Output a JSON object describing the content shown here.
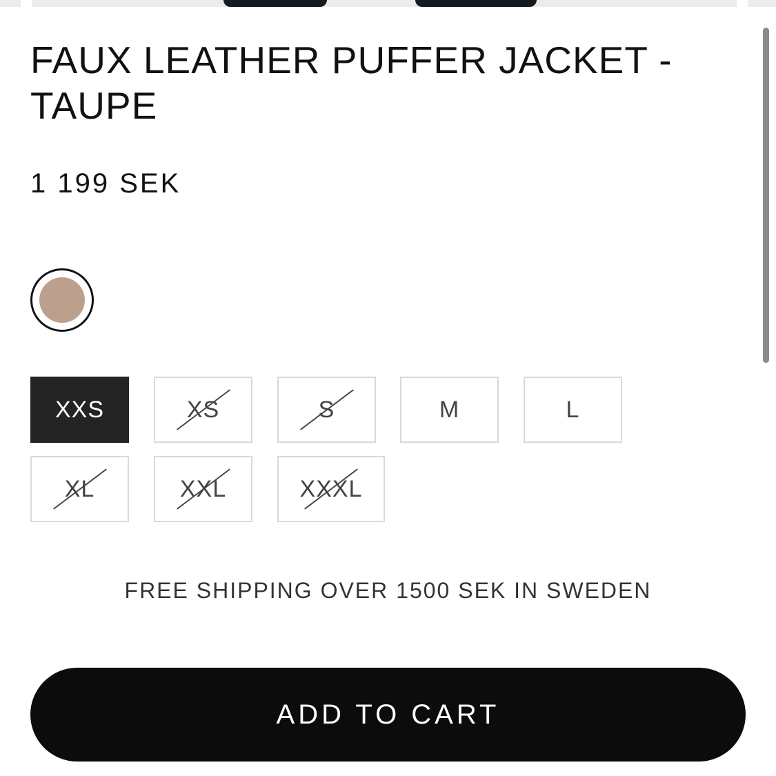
{
  "product": {
    "title": "FAUX LEATHER PUFFER JACKET - TAUPE",
    "price": "1 199 SEK"
  },
  "colors": [
    {
      "name": "taupe",
      "hex": "#bca08d",
      "selected": true
    }
  ],
  "sizes": [
    {
      "label": "XXS",
      "selected": true,
      "available": true
    },
    {
      "label": "XS",
      "selected": false,
      "available": false
    },
    {
      "label": "S",
      "selected": false,
      "available": false
    },
    {
      "label": "M",
      "selected": false,
      "available": true
    },
    {
      "label": "L",
      "selected": false,
      "available": true
    },
    {
      "label": "XL",
      "selected": false,
      "available": false
    },
    {
      "label": "XXL",
      "selected": false,
      "available": false
    },
    {
      "label": "XXXL",
      "selected": false,
      "available": false
    }
  ],
  "shipping_notice": "FREE SHIPPING OVER 1500 SEK IN SWEDEN",
  "cart": {
    "add_label": "ADD TO CART"
  },
  "theme": {
    "accent": "#0c0c0c",
    "selected_size_bg": "#242424",
    "border": "#d9d9d9"
  }
}
